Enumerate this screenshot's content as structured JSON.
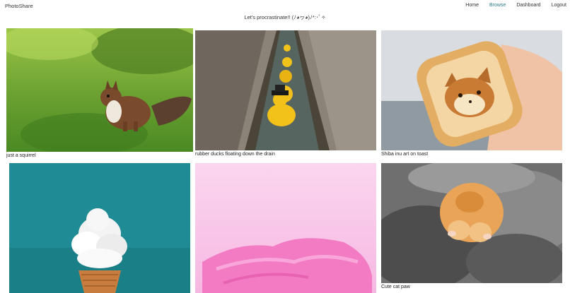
{
  "app": {
    "brand": "PhotoShare"
  },
  "nav": [
    {
      "label": "Home"
    },
    {
      "label": "Browse"
    },
    {
      "label": "Dashboard"
    },
    {
      "label": "Logout"
    }
  ],
  "tagline": "Let's procrastinate!! (ﾉ◕ヮ◕)ﾉ*:･ﾟ✧",
  "photos": [
    {
      "caption": "just a squirrel"
    },
    {
      "caption": "rubber ducks floating down the drain"
    },
    {
      "caption": "Shiba inu art on toast"
    },
    {
      "caption": ""
    },
    {
      "caption": ""
    },
    {
      "caption": "Cute cat paw"
    }
  ],
  "colors": {
    "active_nav": "#2a7d8c"
  }
}
